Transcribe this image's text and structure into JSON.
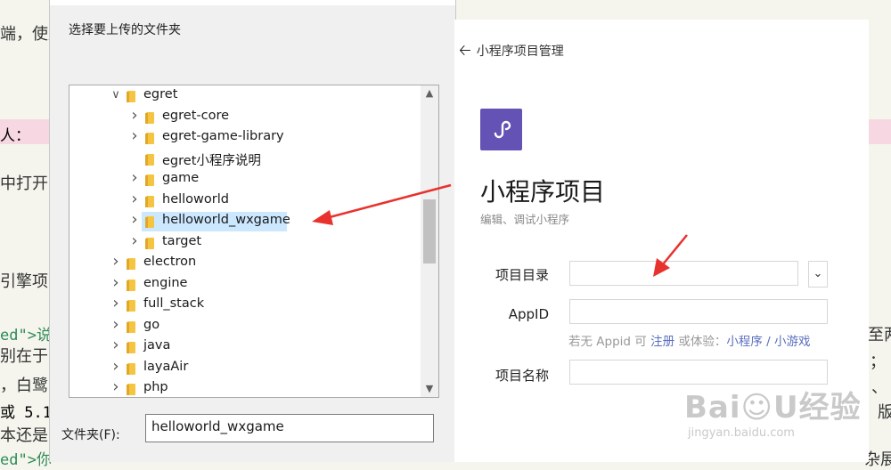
{
  "background": {
    "fragments": [
      {
        "text": "端，使用",
        "cls": "bg-text",
        "pos": "f1"
      },
      {
        "text": "人：",
        "cls": "bg-code",
        "pos": "f2"
      },
      {
        "text": "中打开",
        "cls": "bg-text",
        "pos": "f3"
      },
      {
        "text": "引擎项",
        "cls": "bg-text",
        "pos": "f4"
      },
      {
        "text": "ed\">说",
        "cls": "bg-code green",
        "pos": "f5"
      },
      {
        "text": "别在于引",
        "cls": "bg-text",
        "pos": "f6"
      },
      {
        "text": "，白鹭",
        "cls": "bg-text",
        "pos": "f7"
      },
      {
        "text": "或 5.1",
        "cls": "bg-code",
        "pos": "f8"
      },
      {
        "text": "本还是",
        "cls": "bg-text",
        "pos": "f9"
      },
      {
        "text": "ed\">你",
        "cls": "bg-code green",
        "pos": "f10"
      },
      {
        "text": "至两",
        "cls": "bg-text",
        "pos": "f11"
      },
      {
        "text": "；",
        "cls": "bg-text",
        "pos": "f12"
      },
      {
        "text": "、",
        "cls": "bg-text",
        "pos": "f13"
      },
      {
        "text": "版",
        "cls": "bg-text",
        "pos": "f14"
      },
      {
        "text": "杂展",
        "cls": "bg-text",
        "pos": "f15"
      }
    ]
  },
  "folder_dialog": {
    "title": "选择要上传的文件夹",
    "tree": [
      {
        "label": "egret",
        "expanded": true,
        "level": 0,
        "has_children": true
      },
      {
        "label": "egret-core",
        "level": 1,
        "has_children": true
      },
      {
        "label": "egret-game-library",
        "level": 1,
        "has_children": true
      },
      {
        "label": "egret小程序说明",
        "level": 1,
        "has_children": false
      },
      {
        "label": "game",
        "level": 1,
        "has_children": true
      },
      {
        "label": "helloworld",
        "level": 1,
        "has_children": true
      },
      {
        "label": "helloworld_wxgame",
        "level": 1,
        "has_children": true,
        "selected": true
      },
      {
        "label": "target",
        "level": 1,
        "has_children": true
      },
      {
        "label": "electron",
        "level": 0,
        "has_children": true
      },
      {
        "label": "engine",
        "level": 0,
        "has_children": true
      },
      {
        "label": "full_stack",
        "level": 0,
        "has_children": true
      },
      {
        "label": "go",
        "level": 0,
        "has_children": true
      },
      {
        "label": "java",
        "level": 0,
        "has_children": true
      },
      {
        "label": "layaAir",
        "level": 0,
        "has_children": true
      },
      {
        "label": "php",
        "level": 0,
        "has_children": true
      }
    ],
    "folder_label": "文件夹(F):",
    "folder_value": "helloworld_wxgame"
  },
  "project_panel": {
    "back_label": "小程序项目管理",
    "title": "小程序项目",
    "subtitle": "编辑、调试小程序",
    "dir_label": "项目目录",
    "dir_value": "",
    "appid_label": "AppID",
    "appid_value": "",
    "hint_prefix": "若无 Appid 可 ",
    "hint_register": "注册",
    "hint_middle": " 或体验：",
    "hint_miniprogram": "小程序",
    "hint_sep": " / ",
    "hint_minigame": "小游戏",
    "name_label": "项目名称",
    "name_value": ""
  },
  "watermark": {
    "main": "Bai☺U经验",
    "sub": "jingyan.baidu.com"
  },
  "colors": {
    "accent_purple": "#6452b4",
    "link_blue": "#5a6fbf",
    "annotation_red": "#e8322e",
    "selection": "#cce8ff"
  }
}
